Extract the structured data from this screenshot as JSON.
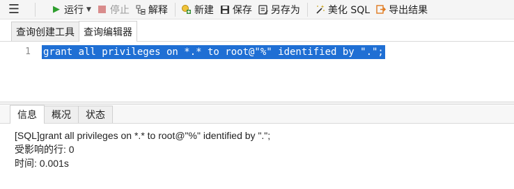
{
  "toolbar": {
    "menu_icon": "menu-icon",
    "run_label": "运行",
    "stop_label": "停止",
    "explain_label": "解释",
    "new_label": "新建",
    "save_label": "保存",
    "save_as_label": "另存为",
    "beautify_label": "美化 SQL",
    "export_label": "导出结果",
    "colors": {
      "run": "#2e9e2e",
      "stop": "#d98c8c",
      "new": "#3a8f3a",
      "beautify": "#c8a21a",
      "export": "#e07a1f"
    }
  },
  "top_tabs": [
    {
      "label": "查询创建工具",
      "active": false
    },
    {
      "label": "查询编辑器",
      "active": true
    }
  ],
  "editor": {
    "line_number": "1",
    "code": "grant all privileges on *.* to root@\"%\" identified by \".\";",
    "selection_color": "#1f6fd4"
  },
  "bottom_tabs": [
    {
      "label": "信息",
      "active": true
    },
    {
      "label": "概况",
      "active": false
    },
    {
      "label": "状态",
      "active": false
    }
  ],
  "output": {
    "lines": [
      "[SQL]grant all privileges on *.* to root@\"%\" identified by \".\";",
      "受影响的行: 0",
      "时间: 0.001s"
    ]
  }
}
